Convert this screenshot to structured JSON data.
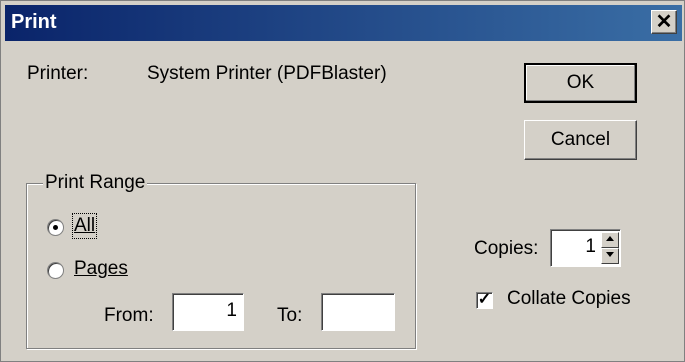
{
  "dialog": {
    "title": "Print",
    "close_glyph": "✕"
  },
  "printer": {
    "label": "Printer:",
    "value": "System Printer (PDFBlaster)"
  },
  "buttons": {
    "ok": "OK",
    "cancel": "Cancel"
  },
  "print_range": {
    "legend": "Print Range",
    "all_label": "All",
    "pages_label": "Pages",
    "selected": "All",
    "from_label": "From:",
    "from_value": "1",
    "to_label": "To:",
    "to_value": ""
  },
  "copies": {
    "label": "Copies:",
    "value": "1",
    "collate_label": "Collate Copies",
    "collate_checked": true
  }
}
